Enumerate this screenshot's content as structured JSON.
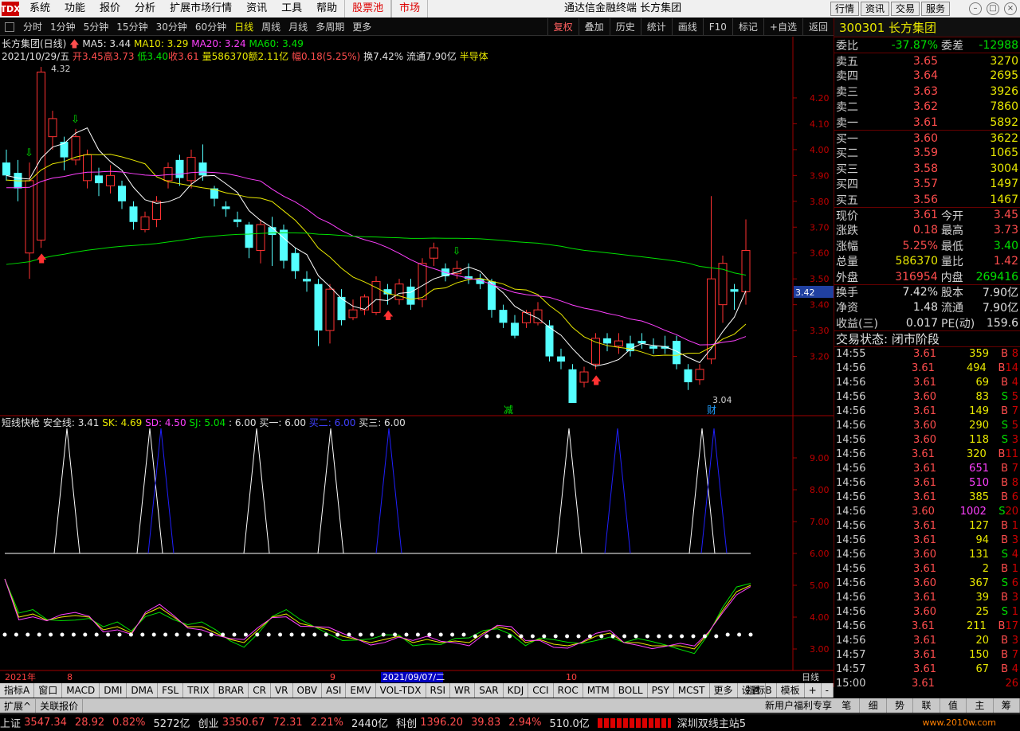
{
  "menubar": {
    "logo": "TDX",
    "items": [
      "系统",
      "功能",
      "报价",
      "分析",
      "扩展市场行情",
      "资讯",
      "工具",
      "帮助"
    ],
    "red_items": [
      "股票池",
      "市场"
    ],
    "title": "通达信金融终端  长方集团",
    "right_buttons": [
      "行情",
      "资讯",
      "交易",
      "服务"
    ]
  },
  "periodbar": {
    "items": [
      "分时",
      "1分钟",
      "5分钟",
      "15分钟",
      "30分钟",
      "60分钟",
      "日线",
      "周线",
      "月线",
      "多周期",
      "更多"
    ],
    "selected": "日线",
    "tools": [
      "复权",
      "叠加",
      "历史",
      "统计",
      "画线",
      "F10",
      "标记",
      "+自选",
      "返回"
    ],
    "tool_selected": "复权"
  },
  "kline_header": {
    "name": "长方集团(日线)",
    "ma5": "MA5: 3.44",
    "ma10": "MA10: 3.29",
    "ma20": "MA20: 3.24",
    "ma60": "MA60: 3.49",
    "date": "2021/10/29/五",
    "open": "开3.45",
    "high": "高3.73",
    "low": "低3.40",
    "close": "收3.61",
    "vol": "量586370",
    "amt": "额2.11亿",
    "chg": "幅0.18(5.25%)",
    "turnover": "换7.42%",
    "float": "流通7.90亿",
    "sector": "半导体"
  },
  "price_axis": [
    "4.20",
    "4.10",
    "4.00",
    "3.90",
    "3.80",
    "3.70",
    "3.60",
    "3.50",
    "3.40",
    "3.30",
    "3.20"
  ],
  "current_price_tag": "3.42",
  "annotations": {
    "high": "4.32",
    "low": "3.04",
    "mark_jian": "减",
    "mark_cai": "财"
  },
  "sub1_header": {
    "name": "短线快枪",
    "safe": "安全线: 3.41",
    "sk": "SK: 4.69",
    "sd": "SD: 4.50",
    "sj": "SJ: 5.04",
    "blank": ": 6.00",
    "buy1": "买一: 6.00",
    "buy2": "买二: 6.00",
    "buy3": "买三: 6.00"
  },
  "sub1_axis": [
    "9.00",
    "8.00",
    "7.00",
    "6.00",
    "5.00",
    "4.00",
    "3.00"
  ],
  "date_axis": {
    "year": "2021年",
    "m8": "8",
    "m9": "9",
    "m10": "10",
    "cursor_date": "2021/09/07/二",
    "period": "日线"
  },
  "indicators": [
    "指标A",
    "窗口",
    "MACD",
    "DMI",
    "DMA",
    "FSL",
    "TRIX",
    "BRAR",
    "CR",
    "VR",
    "OBV",
    "ASI",
    "EMV",
    "VOL-TDX",
    "RSI",
    "WR",
    "SAR",
    "KDJ",
    "CCI",
    "ROC",
    "MTM",
    "BOLL",
    "PSY",
    "MCST",
    "更多",
    "设置"
  ],
  "ind_right": [
    "指标B",
    "模板",
    "+",
    "-"
  ],
  "ext": [
    "扩展^",
    "关联报价"
  ],
  "ext_right": "新用户福利专享",
  "quote": {
    "code": "300301",
    "name": "长方集团",
    "rows": [
      {
        "a": "委比",
        "b": "-37.87%",
        "c": "",
        "d": "委差",
        "e": "-12988",
        "bc": "grn",
        "ec": "grn"
      },
      {
        "a": "卖五",
        "b": "3.65",
        "c": "3270",
        "bc": "red"
      },
      {
        "a": "卖四",
        "b": "3.64",
        "c": "2695",
        "bc": "red"
      },
      {
        "a": "卖三",
        "b": "3.63",
        "c": "3926",
        "bc": "red"
      },
      {
        "a": "卖二",
        "b": "3.62",
        "c": "7860",
        "bc": "red"
      },
      {
        "a": "卖一",
        "b": "3.61",
        "c": "5892",
        "bc": "red"
      },
      {
        "a": "买一",
        "b": "3.60",
        "c": "3622",
        "bc": "red"
      },
      {
        "a": "买二",
        "b": "3.59",
        "c": "1065",
        "bc": "red"
      },
      {
        "a": "买三",
        "b": "3.58",
        "c": "3004",
        "bc": "red"
      },
      {
        "a": "买四",
        "b": "3.57",
        "c": "1497",
        "bc": "red"
      },
      {
        "a": "买五",
        "b": "3.56",
        "c": "1467",
        "bc": "red"
      },
      {
        "a": "现价",
        "b": "3.61",
        "d": "今开",
        "e": "3.45",
        "bc": "red",
        "ec": "red"
      },
      {
        "a": "涨跌",
        "b": "0.18",
        "d": "最高",
        "e": "3.73",
        "bc": "red",
        "ec": "red"
      },
      {
        "a": "涨幅",
        "b": "5.25%",
        "d": "最低",
        "e": "3.40",
        "bc": "red",
        "ec": "grn"
      },
      {
        "a": "总量",
        "b": "586370",
        "d": "量比",
        "e": "1.42",
        "bc": "yel",
        "ec": "red"
      },
      {
        "a": "外盘",
        "b": "316954",
        "d": "内盘",
        "e": "269416",
        "bc": "red",
        "ec": "grn"
      },
      {
        "a": "换手",
        "b": "7.42%",
        "d": "股本",
        "e": "7.90亿",
        "bc": "wht",
        "ec": "wht"
      },
      {
        "a": "净资",
        "b": "1.48",
        "d": "流通",
        "e": "7.90亿",
        "bc": "wht",
        "ec": "wht"
      },
      {
        "a": "收益(三)",
        "b": "0.017",
        "d": "PE(动)",
        "e": "159.6",
        "bc": "wht",
        "ec": "wht"
      }
    ],
    "trade_status": "交易状态: 闭市阶段"
  },
  "ticks": [
    [
      "14:55",
      "3.61",
      "359",
      "B",
      "8"
    ],
    [
      "14:56",
      "3.61",
      "494",
      "B",
      "14"
    ],
    [
      "14:56",
      "3.61",
      "69",
      "B",
      "4"
    ],
    [
      "14:56",
      "3.60",
      "83",
      "S",
      "5"
    ],
    [
      "14:56",
      "3.61",
      "149",
      "B",
      "7"
    ],
    [
      "14:56",
      "3.60",
      "290",
      "S",
      "5"
    ],
    [
      "14:56",
      "3.60",
      "118",
      "S",
      "3"
    ],
    [
      "14:56",
      "3.61",
      "320",
      "B",
      "11"
    ],
    [
      "14:56",
      "3.61",
      "651",
      "B",
      "7"
    ],
    [
      "14:56",
      "3.61",
      "510",
      "B",
      "8"
    ],
    [
      "14:56",
      "3.61",
      "385",
      "B",
      "6"
    ],
    [
      "14:56",
      "3.60",
      "1002",
      "S",
      "20"
    ],
    [
      "14:56",
      "3.61",
      "127",
      "B",
      "1"
    ],
    [
      "14:56",
      "3.61",
      "94",
      "B",
      "3"
    ],
    [
      "14:56",
      "3.60",
      "131",
      "S",
      "4"
    ],
    [
      "14:56",
      "3.61",
      "2",
      "B",
      "1"
    ],
    [
      "14:56",
      "3.60",
      "367",
      "S",
      "6"
    ],
    [
      "14:56",
      "3.61",
      "39",
      "B",
      "3"
    ],
    [
      "14:56",
      "3.60",
      "25",
      "S",
      "1"
    ],
    [
      "14:56",
      "3.61",
      "211",
      "B",
      "17"
    ],
    [
      "14:56",
      "3.61",
      "20",
      "B",
      "3"
    ],
    [
      "14:57",
      "3.61",
      "150",
      "B",
      "7"
    ],
    [
      "14:57",
      "3.61",
      "67",
      "B",
      "4"
    ],
    [
      "15:00",
      "3.61",
      "",
      "",
      "26"
    ]
  ],
  "tick_buttons": [
    "笔",
    "细",
    "势",
    "联",
    "值",
    "主",
    "筹"
  ],
  "status": {
    "sh_label": "上证",
    "sh_val": "3547.34",
    "sh_chg": "28.92",
    "sh_pct": "0.82%",
    "sh_amt": "5272亿",
    "cy_label": "创业",
    "cy_val": "3350.67",
    "cy_chg": "72.31",
    "cy_pct": "2.21%",
    "cy_amt": "2440亿",
    "kc_label": "科创",
    "kc_val": "1396.20",
    "kc_chg": "39.83",
    "kc_pct": "2.94%",
    "kc_amt": "510.0亿",
    "server": "深圳双线主站5"
  },
  "watermark": "www.2010w.com",
  "chart_data": {
    "type": "candlestick",
    "ylim": [
      3.04,
      4.32
    ],
    "candles": [
      [
        3.95,
        3.9,
        4.0,
        3.88
      ],
      [
        3.91,
        3.85,
        3.96,
        3.8
      ],
      [
        3.6,
        3.88,
        3.95,
        3.5
      ],
      [
        3.65,
        4.3,
        4.32,
        3.62
      ],
      [
        4.05,
        4.12,
        4.15,
        4.0
      ],
      [
        4.03,
        3.97,
        4.05,
        3.92
      ],
      [
        3.96,
        4.05,
        4.08,
        3.94
      ],
      [
        3.88,
        3.98,
        4.0,
        3.85
      ],
      [
        3.9,
        3.87,
        3.93,
        3.82
      ],
      [
        3.86,
        3.9,
        3.94,
        3.83
      ],
      [
        3.86,
        3.8,
        3.88,
        3.77
      ],
      [
        3.78,
        3.72,
        3.8,
        3.69
      ],
      [
        3.69,
        3.74,
        3.76,
        3.68
      ],
      [
        3.73,
        3.8,
        3.82,
        3.7
      ],
      [
        3.88,
        3.93,
        3.95,
        3.85
      ],
      [
        3.96,
        3.89,
        3.98,
        3.86
      ],
      [
        3.88,
        3.97,
        4.0,
        3.85
      ],
      [
        3.95,
        3.9,
        4.02,
        3.88
      ],
      [
        3.85,
        3.81,
        3.86,
        3.78
      ],
      [
        3.78,
        3.77,
        3.8,
        3.74
      ],
      [
        3.73,
        3.72,
        3.76,
        3.7
      ],
      [
        3.71,
        3.62,
        3.72,
        3.58
      ],
      [
        3.61,
        3.71,
        3.73,
        3.56
      ],
      [
        3.7,
        3.67,
        3.74,
        3.55
      ],
      [
        3.69,
        3.57,
        3.71,
        3.54
      ],
      [
        3.6,
        3.53,
        3.62,
        3.5
      ],
      [
        3.5,
        3.49,
        3.53,
        3.45
      ],
      [
        3.48,
        3.3,
        3.5,
        3.24
      ],
      [
        3.3,
        3.46,
        3.48,
        3.25
      ],
      [
        3.43,
        3.34,
        3.46,
        3.32
      ],
      [
        3.35,
        3.38,
        3.42,
        3.34
      ],
      [
        3.38,
        3.43,
        3.44,
        3.36
      ],
      [
        3.37,
        3.49,
        3.51,
        3.36
      ],
      [
        3.46,
        3.44,
        3.48,
        3.4
      ],
      [
        3.42,
        3.48,
        3.5,
        3.4
      ],
      [
        3.47,
        3.4,
        3.5,
        3.38
      ],
      [
        3.42,
        3.56,
        3.58,
        3.39
      ],
      [
        3.58,
        3.62,
        3.64,
        3.55
      ],
      [
        3.54,
        3.51,
        3.56,
        3.49
      ],
      [
        3.52,
        3.54,
        3.57,
        3.5
      ],
      [
        3.51,
        3.5,
        3.56,
        3.48
      ],
      [
        3.5,
        3.48,
        3.52,
        3.46
      ],
      [
        3.49,
        3.38,
        3.5,
        3.35
      ],
      [
        3.38,
        3.33,
        3.4,
        3.31
      ],
      [
        3.33,
        3.28,
        3.36,
        3.27
      ],
      [
        3.33,
        3.37,
        3.38,
        3.31
      ],
      [
        3.33,
        3.38,
        3.41,
        3.32
      ],
      [
        3.32,
        3.2,
        3.34,
        3.18
      ],
      [
        3.2,
        3.18,
        3.23,
        3.15
      ],
      [
        3.15,
        3.02,
        3.17,
        3.02
      ],
      [
        3.1,
        3.14,
        3.16,
        3.08
      ],
      [
        3.17,
        3.27,
        3.29,
        3.15
      ],
      [
        3.27,
        3.25,
        3.29,
        3.22
      ],
      [
        3.24,
        3.26,
        3.29,
        3.21
      ],
      [
        3.25,
        3.22,
        3.28,
        3.2
      ],
      [
        3.26,
        3.25,
        3.29,
        3.23
      ],
      [
        3.24,
        3.23,
        3.27,
        3.21
      ],
      [
        3.24,
        3.23,
        3.28,
        3.21
      ],
      [
        3.26,
        3.17,
        3.28,
        3.15
      ],
      [
        3.15,
        3.1,
        3.17,
        3.07
      ],
      [
        3.11,
        3.15,
        3.17,
        3.09
      ],
      [
        3.19,
        3.5,
        3.82,
        3.17
      ],
      [
        3.4,
        3.56,
        3.59,
        3.33
      ],
      [
        3.46,
        3.45,
        3.48,
        3.38
      ],
      [
        3.45,
        3.61,
        3.73,
        3.4
      ]
    ]
  }
}
